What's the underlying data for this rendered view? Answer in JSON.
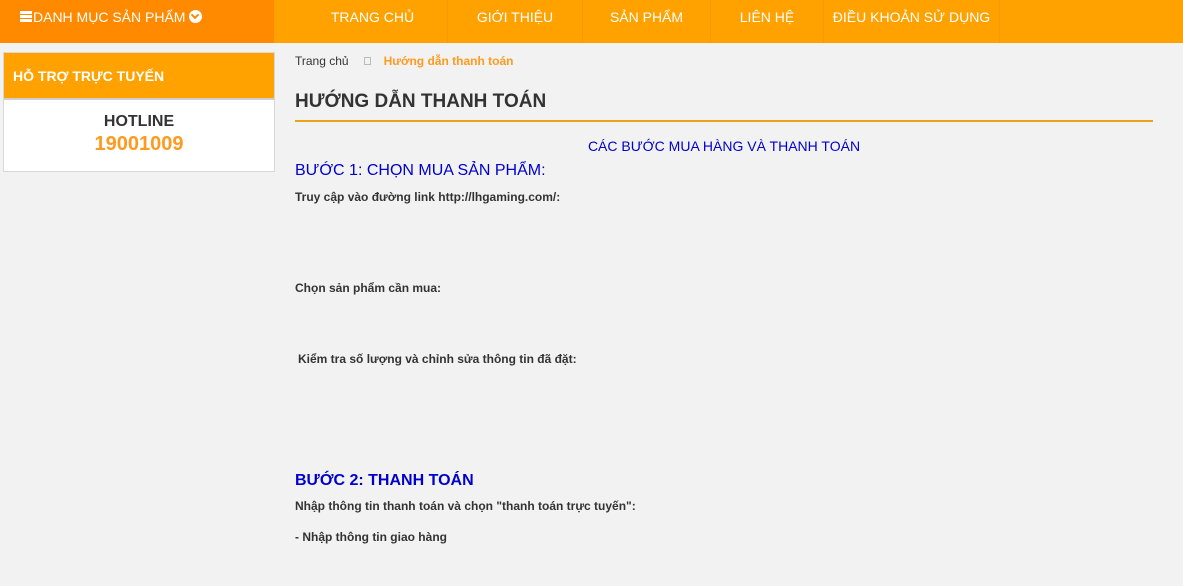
{
  "header": {
    "category_menu_label": "DANH MỤC SẢN PHẨM",
    "nav": [
      "TRANG CHỦ",
      "GIỚI THIỆU",
      "SẢN PHẨM",
      "LIÊN HỆ",
      "ĐIỀU KHOẢN SỬ DỤNG"
    ]
  },
  "sidebar": {
    "support_title": "HỖ TRỢ TRỰC TUYẾN",
    "hotline_label": "HOTLINE",
    "hotline_number": "19001009"
  },
  "breadcrumb": {
    "home": "Trang chủ",
    "current": "Hướng dẫn thanh toán"
  },
  "main": {
    "title": "HƯỚNG DẪN THANH TOÁN",
    "steps_heading": "CÁC BƯỚC MUA HÀNG VÀ THANH TOÁN",
    "step1_heading": "BƯỚC 1:  CHỌN MUA SẢN PHẨM:",
    "step1_access": "Truy cập vào đường link http://lhgaming.com/:",
    "step1_choose": "Chọn sản phẩm cần mua:",
    "step1_check": "Kiểm tra số lượng và chỉnh sửa thông tin đã đặt:",
    "step2_heading": "BƯỚC 2: THANH TOÁN",
    "step2_enter": "Nhập thông tin thanh toán và chọn \"thanh toán trực tuyến\":",
    "step2_shipping": "- Nhập thông tin giao hàng"
  },
  "colors": {
    "nav_bg": "#ffa200",
    "category_bg": "#ff8a00",
    "accent_orange": "#ff9a1e",
    "link_blue": "#0000cc"
  }
}
